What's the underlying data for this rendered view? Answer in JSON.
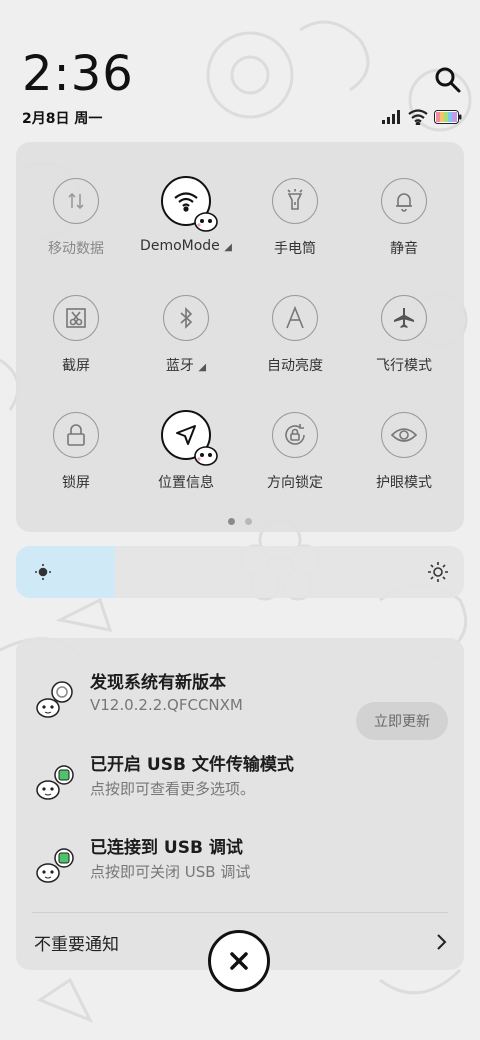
{
  "status": {
    "time": "2:36",
    "date": "2月8日 周一",
    "battery_level": 1.0
  },
  "icons": {
    "search": "search-icon",
    "signal": "signal-icon",
    "wifi": "wifi-icon",
    "battery": "battery-icon"
  },
  "tiles": [
    {
      "label": "移动数据",
      "icon": "mobile-data-icon",
      "active": false
    },
    {
      "label": "DemoMode",
      "icon": "wifi-icon",
      "active": true,
      "caret": "◢"
    },
    {
      "label": "手电筒",
      "icon": "flashlight-icon",
      "active": false
    },
    {
      "label": "静音",
      "icon": "bell-icon",
      "active": false
    },
    {
      "label": "截屏",
      "icon": "screenshot-icon",
      "active": false
    },
    {
      "label": "蓝牙",
      "icon": "bluetooth-icon",
      "active": false,
      "caret": "◢"
    },
    {
      "label": "自动亮度",
      "icon": "auto-brightness-icon",
      "active": false
    },
    {
      "label": "飞行模式",
      "icon": "airplane-icon",
      "active": false
    },
    {
      "label": "锁屏",
      "icon": "lock-icon",
      "active": false
    },
    {
      "label": "位置信息",
      "icon": "location-icon",
      "active": true
    },
    {
      "label": "方向锁定",
      "icon": "rotation-lock-icon",
      "active": false
    },
    {
      "label": "护眼模式",
      "icon": "eye-icon",
      "active": false
    }
  ],
  "brightness": {
    "level": 0.22,
    "fill_color": "#cfe9f7"
  },
  "notifications": [
    {
      "title": "发现系统有新版本",
      "subtitle": "V12.0.2.2.QFCCNXM",
      "action": "立即更新"
    },
    {
      "title": "已开启 USB 文件传输模式",
      "subtitle": "点按即可查看更多选项。"
    },
    {
      "title": "已连接到 USB 调试",
      "subtitle": "点按即可关闭 USB 调试"
    }
  ],
  "unimportant_label": "不重要通知",
  "colors": {
    "panel": "#e0e0e0",
    "active_tile_border": "#111111",
    "brightness_fill": "#cfe9f7"
  }
}
